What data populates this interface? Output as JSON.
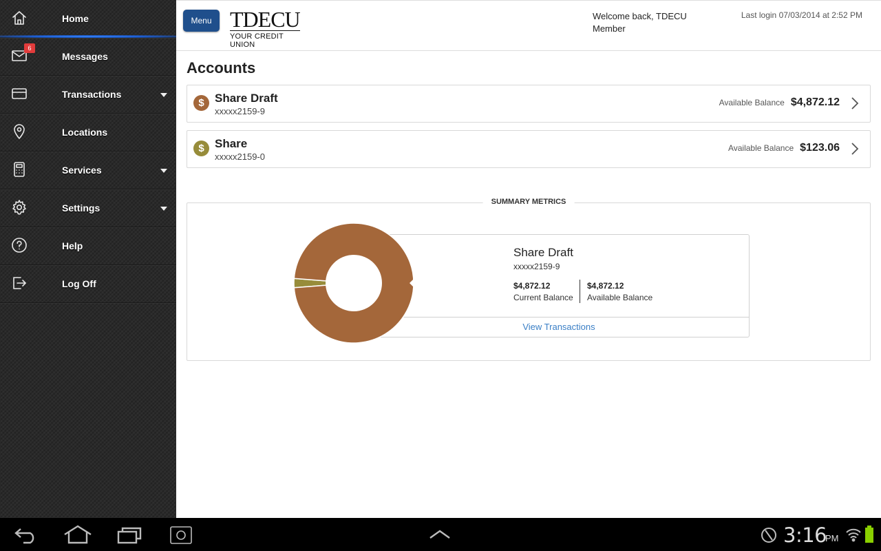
{
  "sidebar": {
    "items": [
      {
        "label": "Home",
        "icon": "home-icon"
      },
      {
        "label": "Messages",
        "icon": "envelope-icon",
        "badge": "6"
      },
      {
        "label": "Transactions",
        "icon": "card-icon"
      },
      {
        "label": "Locations",
        "icon": "map-pin-icon"
      },
      {
        "label": "Services",
        "icon": "calculator-icon"
      },
      {
        "label": "Settings",
        "icon": "gear-icon"
      },
      {
        "label": "Help",
        "icon": "help-icon"
      },
      {
        "label": "Log Off",
        "icon": "logout-icon"
      }
    ],
    "active": "Home",
    "accent_color": "#2f7bff"
  },
  "header": {
    "menu_label": "Menu",
    "logo_main": "TDECU",
    "logo_sub": "YOUR CREDIT UNION",
    "welcome": "Welcome back, TDECU Member",
    "last_login": "Last login 07/03/2014 at 2:52 PM"
  },
  "main": {
    "title": "Accounts",
    "accounts": [
      {
        "name": "Share Draft",
        "number": "xxxxx2159-9",
        "avail_label": "Available Balance",
        "balance": "$4,872.12",
        "color": "#a4673a",
        "coin": "$"
      },
      {
        "name": "Share",
        "number": "xxxxx2159-0",
        "avail_label": "Available Balance",
        "balance": "$123.06",
        "color": "#978c3a",
        "coin": "$"
      }
    ],
    "metrics": {
      "title": "SUMMARY METRICS",
      "selected_name": "Share Draft",
      "selected_number": "xxxxx2159-9",
      "current_amount": "$4,872.12",
      "current_label": "Current Balance",
      "available_amount": "$4,872.12",
      "available_label": "Available Balance",
      "link": "View Transactions",
      "link_color": "#3a7fc6"
    }
  },
  "chart_data": {
    "type": "pie",
    "categories": [
      "Share Draft",
      "Share"
    ],
    "values": [
      4872.12,
      123.06
    ],
    "colors": [
      "#a4673a",
      "#978c3a"
    ]
  },
  "statusbar": {
    "time": "3:16",
    "ampm": "PM"
  }
}
